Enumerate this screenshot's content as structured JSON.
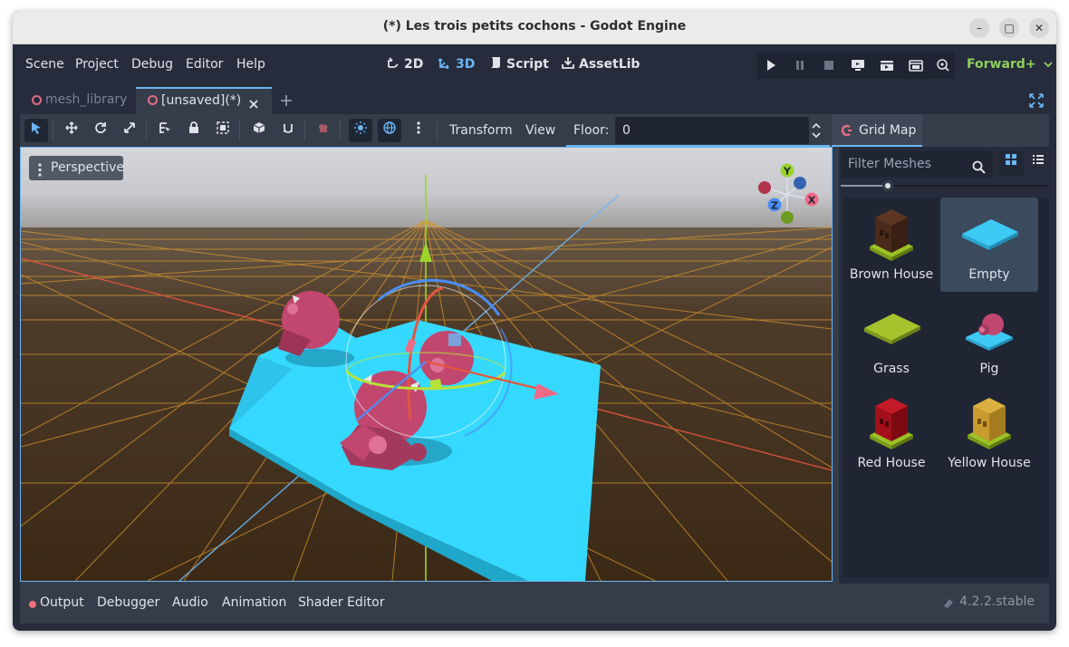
{
  "window": {
    "title": "(*) Les trois petits cochons - Godot Engine"
  },
  "menu": [
    "Scene",
    "Project",
    "Debug",
    "Editor",
    "Help"
  ],
  "workspaces": [
    {
      "label": "2D",
      "icon": "2d-icon"
    },
    {
      "label": "3D",
      "icon": "3d-icon",
      "active": true
    },
    {
      "label": "Script",
      "icon": "script-icon"
    },
    {
      "label": "AssetLib",
      "icon": "assetlib-icon"
    }
  ],
  "renderer": "Forward+",
  "tabs": [
    {
      "label": "mesh_library",
      "active": false
    },
    {
      "label": "[unsaved](*)",
      "active": true
    }
  ],
  "toolbar": {
    "transform_label": "Transform",
    "view_label": "View",
    "floor_label": "Floor:",
    "floor_value": "0",
    "gridmap_label": "Grid Map"
  },
  "viewport": {
    "mode_label": "Perspective",
    "gizmo_axes": {
      "y": "Y",
      "x": "X",
      "z": "Z"
    }
  },
  "sidebar": {
    "filter_placeholder": "Filter Meshes",
    "meshes": [
      {
        "label": "Brown House",
        "selected": false
      },
      {
        "label": "Empty",
        "selected": true
      },
      {
        "label": "Grass",
        "selected": false
      },
      {
        "label": "Pig",
        "selected": false
      },
      {
        "label": "Red House",
        "selected": false
      },
      {
        "label": "Yellow House",
        "selected": false
      }
    ]
  },
  "bottom_tabs": [
    "Output",
    "Debugger",
    "Audio",
    "Animation",
    "Shader Editor"
  ],
  "version": "4.2.2.stable",
  "colors": {
    "accent": "#6ab6f5",
    "renderer": "#8fcf5d",
    "bg": "#262c3b",
    "panel": "#363d4a"
  }
}
